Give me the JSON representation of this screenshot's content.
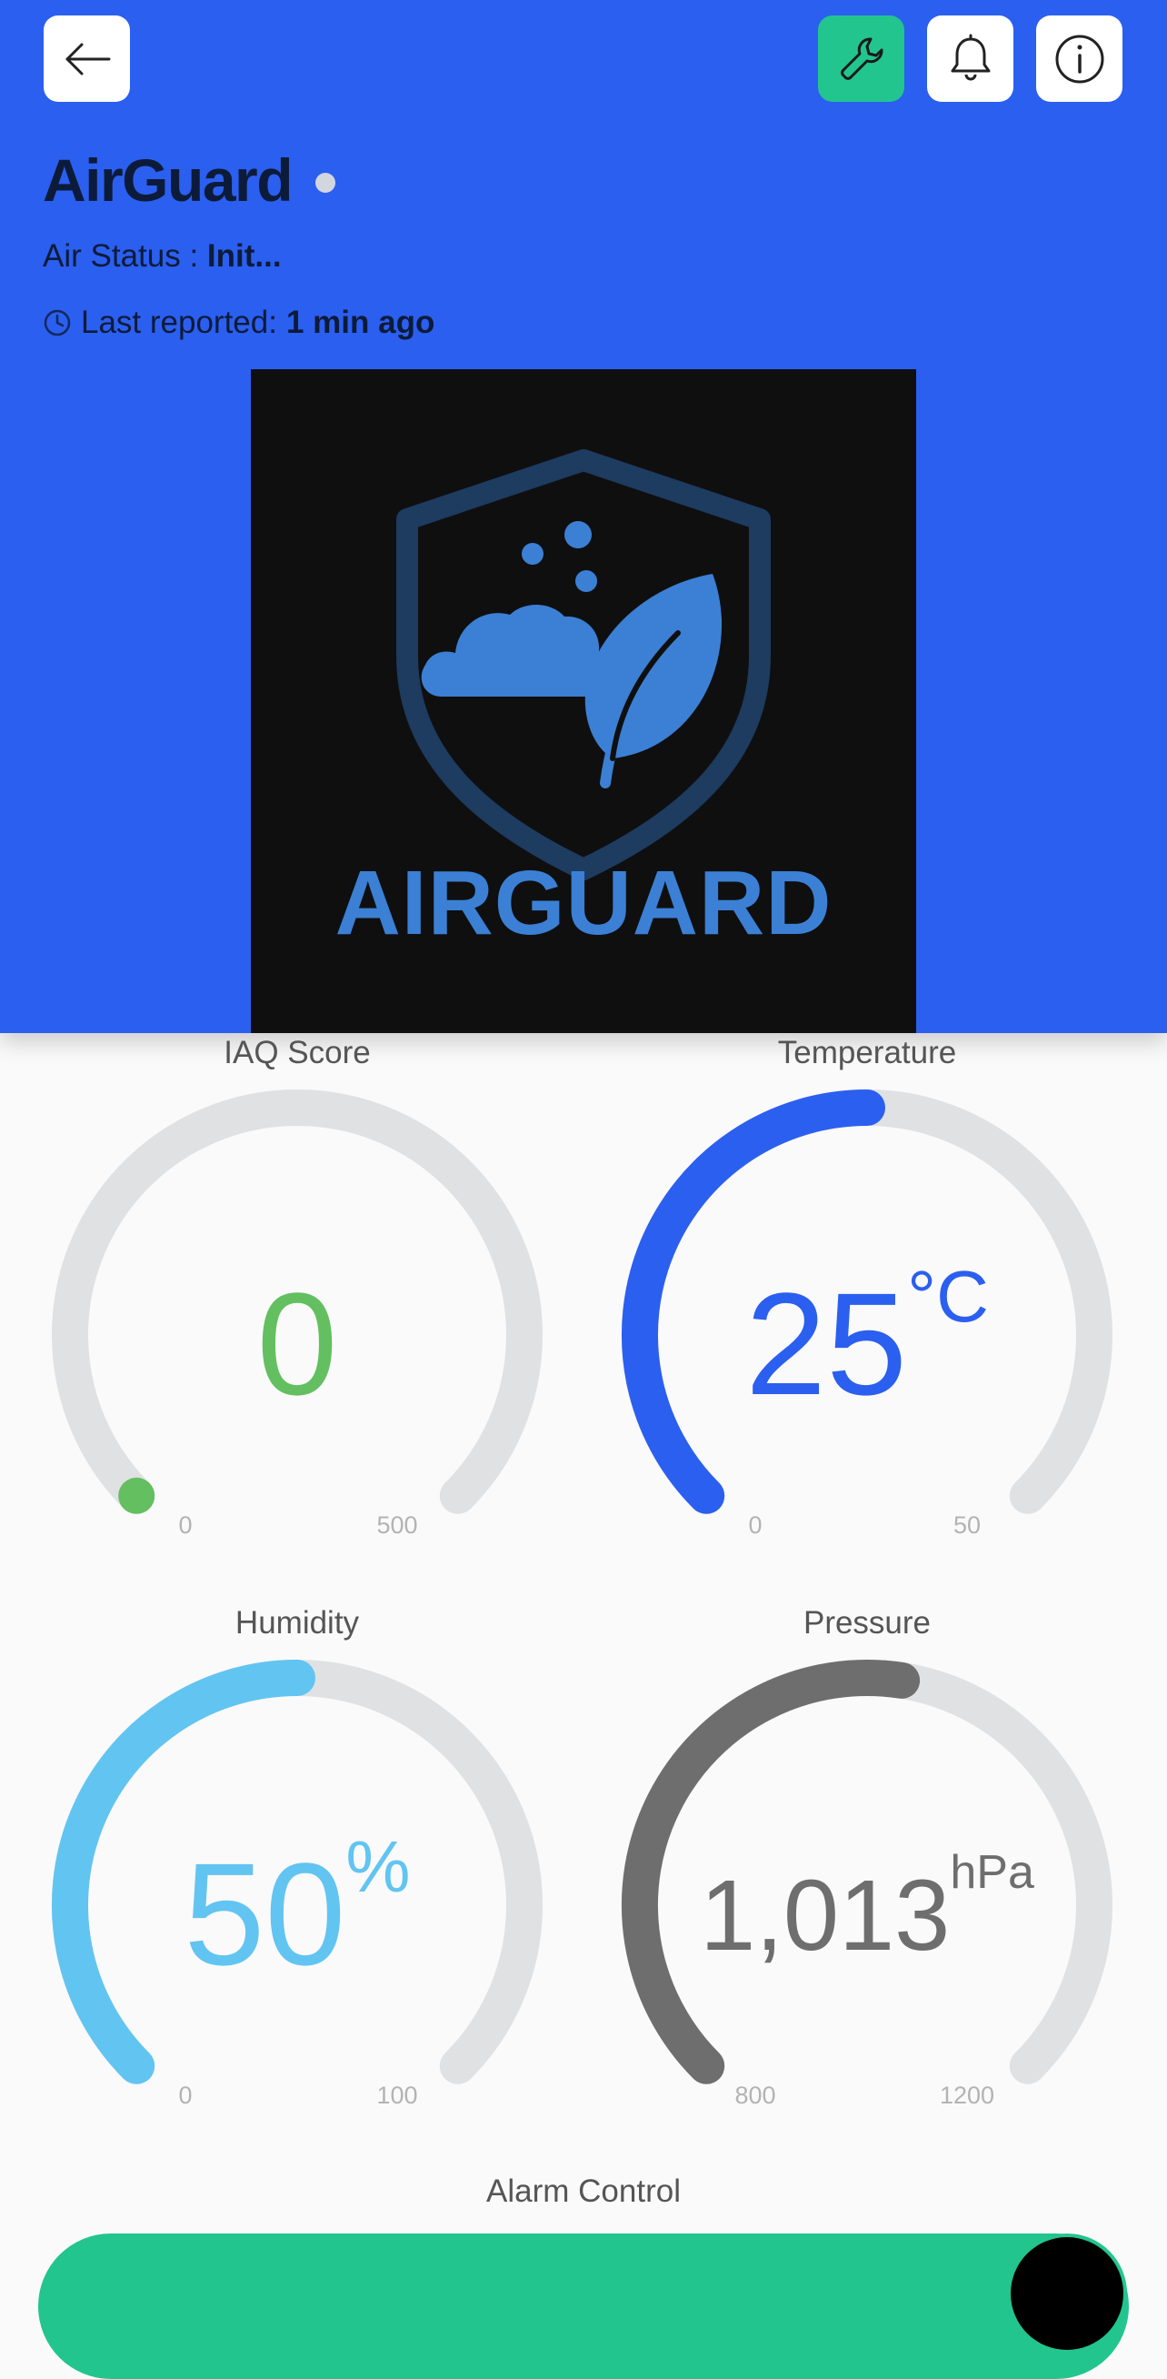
{
  "header": {
    "title": "AirGuard",
    "air_status_label": "Air Status : ",
    "air_status_value": "Init...",
    "last_reported_label": "Last reported:",
    "last_reported_value": "1 min ago",
    "background": "#2b5fef",
    "icons": [
      "back-arrow-icon",
      "wrench-icon",
      "bell-icon",
      "info-icon"
    ],
    "wrench_button_color": "#22c58e"
  },
  "logo": {
    "text": "AIRGUARD",
    "color": "#3b80d4"
  },
  "gauges": [
    {
      "title": "IAQ Score",
      "value": "0",
      "unit": "",
      "min": "0",
      "max": "500",
      "fraction": 0.0,
      "color": "#63bf5f"
    },
    {
      "title": "Temperature",
      "value": "25",
      "unit": "°C",
      "min": "0",
      "max": "50",
      "fraction": 0.5,
      "color": "#2b5fef"
    },
    {
      "title": "Humidity",
      "value": "50",
      "unit": "%",
      "min": "0",
      "max": "100",
      "fraction": 0.5,
      "color": "#62c4f1"
    },
    {
      "title": "Pressure",
      "value": "1,013",
      "unit": "hPa",
      "min": "800",
      "max": "1200",
      "fraction": 0.5325,
      "color": "#6e6e6e"
    }
  ],
  "alarm": {
    "title": "Alarm Control",
    "on": true,
    "color": "#22c58e"
  }
}
